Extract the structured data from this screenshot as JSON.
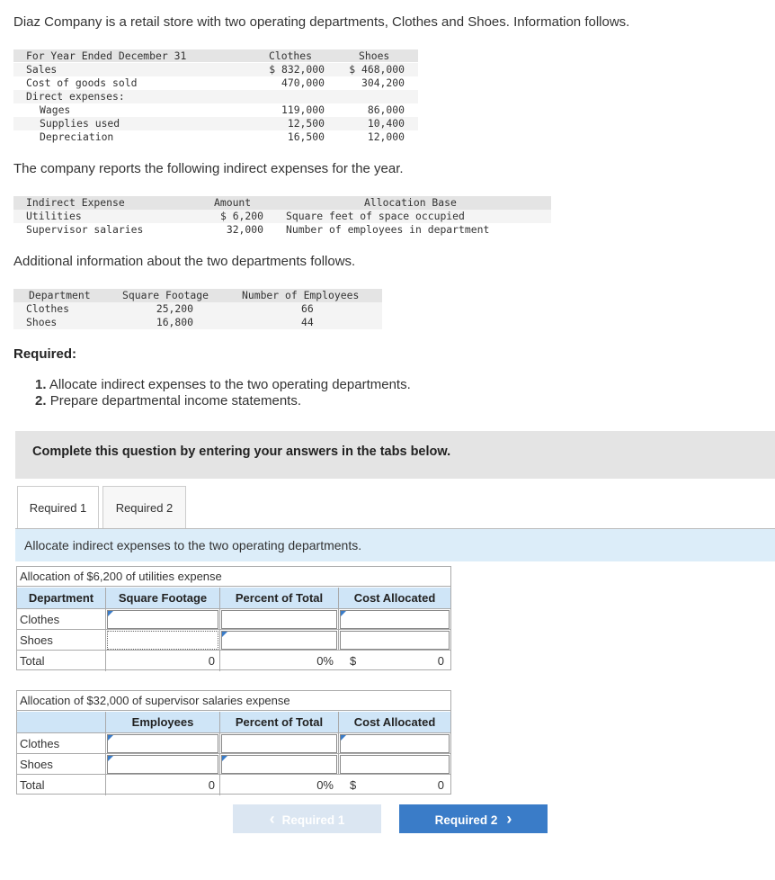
{
  "intro": "Diaz Company is a retail store with two operating departments, Clothes and Shoes. Information follows.",
  "table1": {
    "header": {
      "label": "For Year Ended December 31",
      "c1": "Clothes",
      "c2": "Shoes"
    },
    "rows": [
      {
        "label": "Sales",
        "c1": "$ 832,000",
        "c2": "$ 468,000"
      },
      {
        "label": "Cost of goods sold",
        "c1": "470,000",
        "c2": "304,200"
      },
      {
        "label": "Direct expenses:",
        "c1": "",
        "c2": ""
      },
      {
        "label": "Wages",
        "c1": "119,000",
        "c2": "86,000"
      },
      {
        "label": "Supplies used",
        "c1": "12,500",
        "c2": "10,400"
      },
      {
        "label": "Depreciation",
        "c1": "16,500",
        "c2": "12,000"
      }
    ]
  },
  "para2": "The company reports the following indirect expenses for the year.",
  "table2": {
    "header": {
      "c0": "Indirect Expense",
      "c1": "Amount",
      "c2": "Allocation Base"
    },
    "rows": [
      {
        "c0": "Utilities",
        "c1": "$ 6,200",
        "c2": "Square feet of space occupied"
      },
      {
        "c0": "Supervisor salaries",
        "c1": "32,000",
        "c2": "Number of employees in department"
      }
    ]
  },
  "para3": "Additional information about the two departments follows.",
  "table3": {
    "header": {
      "c0": "Department",
      "c1": "Square Footage",
      "c2": "Number of Employees"
    },
    "rows": [
      {
        "c0": "Clothes",
        "c1": "25,200",
        "c2": "66"
      },
      {
        "c0": "Shoes",
        "c1": "16,800",
        "c2": "44"
      }
    ]
  },
  "required": {
    "title": "Required:",
    "items": [
      {
        "num": "1.",
        "text": "Allocate indirect expenses to the two operating departments."
      },
      {
        "num": "2.",
        "text": "Prepare departmental income statements."
      }
    ]
  },
  "banner": "Complete this question by entering your answers in the tabs below.",
  "tabs": [
    {
      "label": "Required 1"
    },
    {
      "label": "Required 2"
    }
  ],
  "instruction": "Allocate indirect expenses to the two operating departments.",
  "grid1": {
    "caption": "Allocation of $6,200 of utilities expense",
    "headers": {
      "h0": "Department",
      "h1": "Square Footage",
      "h2": "Percent of Total",
      "h3": "Cost Allocated"
    },
    "rows": [
      {
        "label": "Clothes"
      },
      {
        "label": "Shoes"
      }
    ],
    "total": {
      "label": "Total",
      "v1": "0",
      "v2": "0%",
      "cur": "$",
      "v3": "0"
    }
  },
  "grid2": {
    "caption": "Allocation of $32,000 of supervisor salaries expense",
    "headers": {
      "h0": "",
      "h1": "Employees",
      "h2": "Percent of Total",
      "h3": "Cost Allocated"
    },
    "rows": [
      {
        "label": "Clothes"
      },
      {
        "label": "Shoes"
      }
    ],
    "total": {
      "label": "Total",
      "v1": "0",
      "v2": "0%",
      "cur": "$",
      "v3": "0"
    }
  },
  "nav": {
    "prev": "Required 1",
    "next": "Required 2",
    "prev_arrow": "‹",
    "next_arrow": "›"
  }
}
